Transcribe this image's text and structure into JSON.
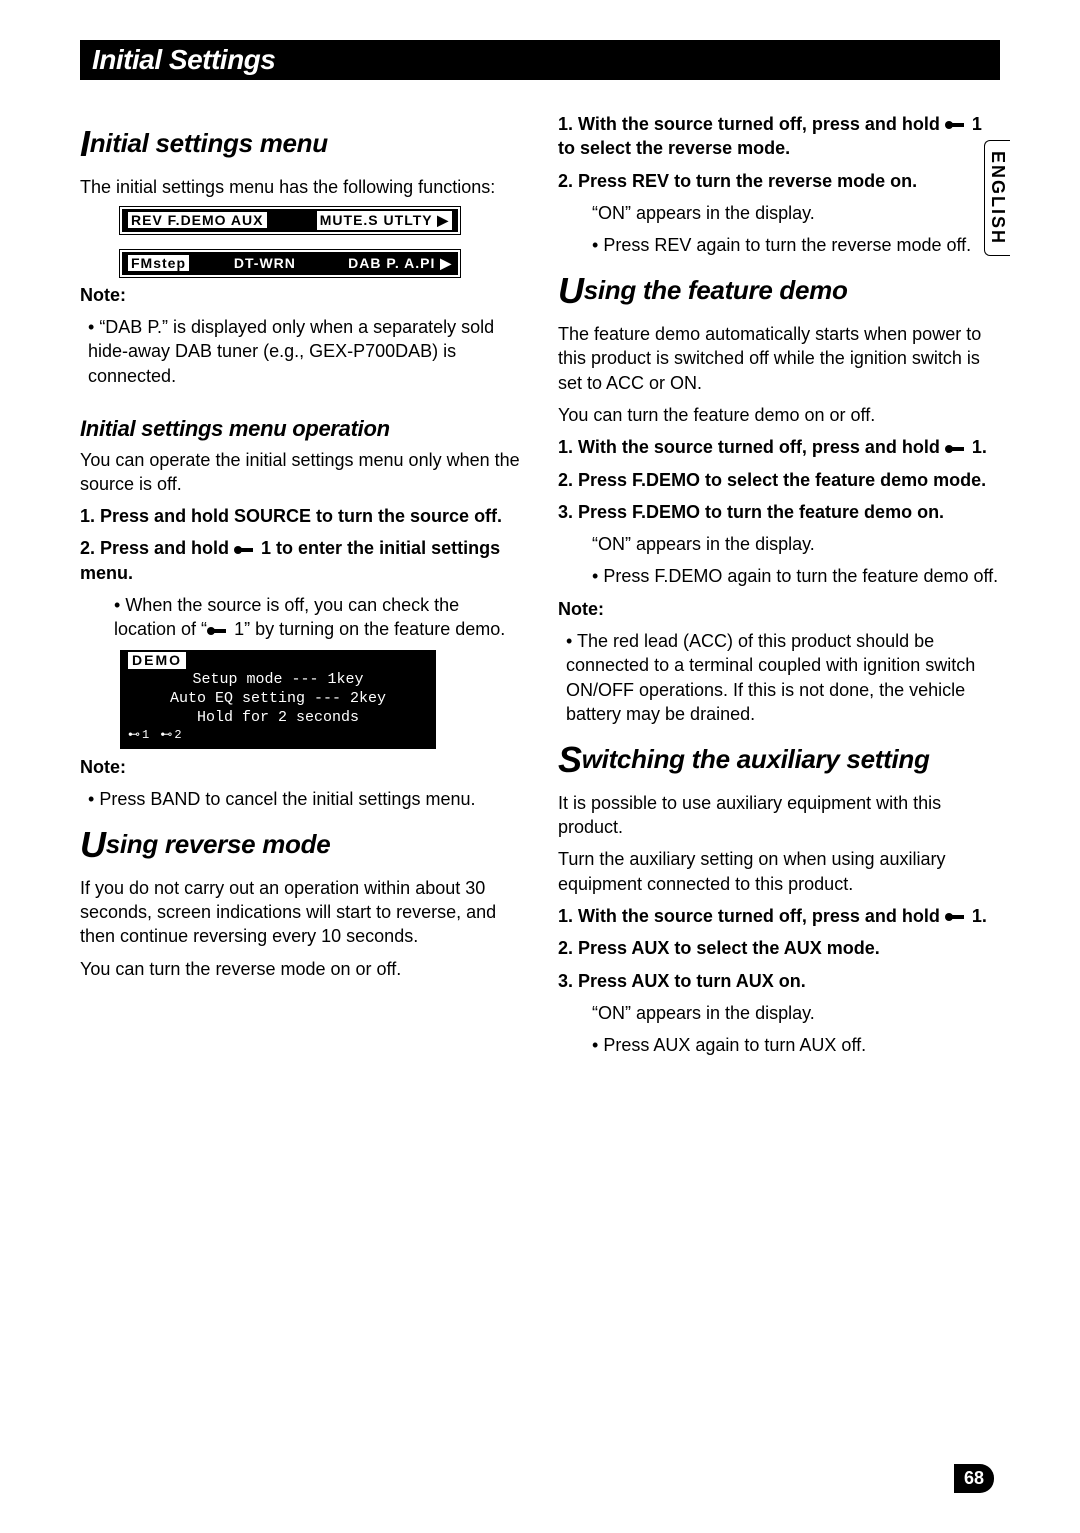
{
  "language_tab": "ENGLISH",
  "title_bar": "Initial Settings",
  "page_number": "68",
  "left": {
    "h1_cap": "I",
    "h1_rest": "nitial settings menu",
    "intro": "The initial settings menu has the following functions:",
    "lcd_row1_a": "REV  F.DEMO  AUX",
    "lcd_row1_b": "MUTE.S  UTLTY  ▶",
    "lcd_row2_a": "FMstep",
    "lcd_row2_b": "DT-WRN",
    "lcd_row2_c": "DAB P.  A.PI  ▶",
    "note1_label": "Note:",
    "note1_text": "“DAB P.” is displayed only when a separately sold hide-away DAB tuner (e.g., GEX-P700DAB) is connected.",
    "h2": "Initial settings menu operation",
    "op_intro": "You can operate the initial settings menu only when the source is off.",
    "step1": "1.  Press and hold SOURCE to turn the source off.",
    "step2a": "2.  Press and hold ",
    "step2b": " 1 to enter the initial settings menu.",
    "step2_sub": "When the source is off, you can check the location of “",
    "step2_sub_end": " 1” by turning on the feature demo.",
    "demo_title": "DEMO",
    "demo_l1": "Setup mode --- 1key",
    "demo_l2": "Auto EQ setting --- 2key",
    "demo_l3": "Hold for 2 seconds",
    "demo_bottom": "⊷1   ⊷2",
    "note2_label": "Note:",
    "note2_text": "Press BAND to cancel the initial settings menu.",
    "h3_cap": "U",
    "h3_rest": "sing reverse mode",
    "reverse_intro": "If you do not carry out an operation within about 30 seconds, screen indications will start to reverse, and then continue reversing every 10 seconds.",
    "reverse_intro2": "You can turn the reverse mode on or off."
  },
  "right": {
    "rev_step1a": "1.  With the source turned off, press and hold ",
    "rev_step1b": " 1 to select the reverse mode.",
    "rev_step2": "2.  Press REV to turn the reverse mode on.",
    "rev_step2_sub1": "“ON” appears in the display.",
    "rev_step2_sub2": "Press REV again to turn the reverse mode off.",
    "h_featdemo_cap": "U",
    "h_featdemo_rest": "sing the feature demo",
    "fd_intro1": "The feature demo automatically starts when power to this product is switched off while the ignition switch is set to ACC or ON.",
    "fd_intro2": "You can turn the feature demo on or off.",
    "fd_step1a": "1.  With the source turned off, press and hold ",
    "fd_step1b": " 1.",
    "fd_step2": "2.  Press F.DEMO to select the feature demo mode.",
    "fd_step3": "3.  Press F.DEMO to turn the feature demo on.",
    "fd_step3_sub1": "“ON” appears in the display.",
    "fd_step3_sub2": "Press F.DEMO again to turn the feature demo off.",
    "fd_note_label": "Note:",
    "fd_note_text": "The red lead (ACC) of this product should be connected to a terminal coupled with ignition switch ON/OFF operations. If this is not done, the vehicle battery may be drained.",
    "h_aux_cap": "S",
    "h_aux_rest": "witching the auxiliary setting",
    "aux_intro1": "It is possible to use auxiliary equipment with this product.",
    "aux_intro2": "Turn the auxiliary setting on when using auxiliary equipment connected to this product.",
    "aux_step1a": "1.  With the source turned off, press and hold ",
    "aux_step1b": " 1.",
    "aux_step2": "2.  Press AUX to select the AUX mode.",
    "aux_step3": "3.  Press AUX to turn AUX on.",
    "aux_step3_sub1": "“ON” appears in the display.",
    "aux_step3_sub2": "Press AUX again to turn AUX off."
  }
}
